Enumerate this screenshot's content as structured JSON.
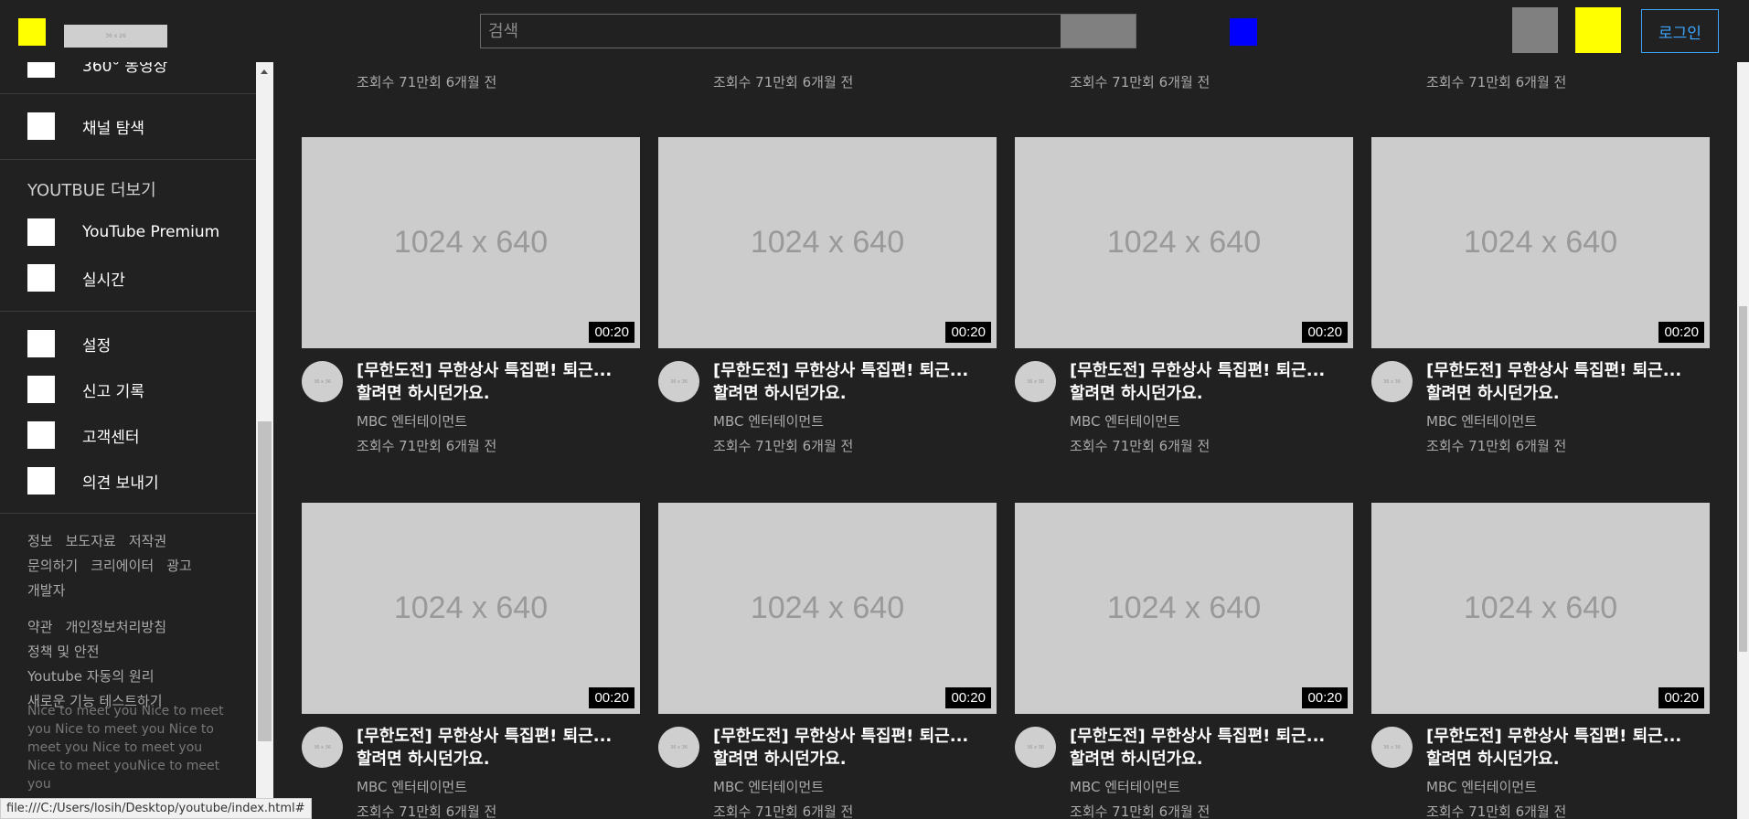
{
  "header": {
    "logo_image_text": "36 x 26",
    "search_placeholder": "검색",
    "login_label": "로그인"
  },
  "sidebar": {
    "partial_top": "360° 동영상",
    "channel_explore": "채널 탐색",
    "more_heading": "YOUTBUE 더보기",
    "more_items": [
      "YouTube Premium",
      "실시간"
    ],
    "settings_items": [
      "설정",
      "신고 기록",
      "고객센터",
      "의견 보내기"
    ],
    "footer_group1": [
      "정보",
      "보도자료",
      "저작권",
      "문의하기",
      "크리에이터",
      "광고",
      "개발자"
    ],
    "footer_group2": [
      "약관",
      "개인정보처리방침",
      "정책 및 안전",
      "Youtube 자동의 원리",
      "새로운 기능 테스트하기"
    ],
    "footer_note": "Nice to meet you Nice to meet you Nice to meet you Nice to meet you Nice to meet you Nice to meet youNice to meet you"
  },
  "video": {
    "thumb_text": "1024 x 640",
    "avatar_text": "36 x 36",
    "duration": "00:20",
    "title_line1": "[무한도전] 무한상사 특집편! 퇴근...",
    "title_line2": "할려면 하시던가요.",
    "channel": "MBC 엔터테이먼트",
    "stats": "조회수 71만회 6개월 전"
  },
  "status_url": "file:///C:/Users/losih/Desktop/youtube/index.html#",
  "colors": {
    "background": "#212121",
    "logo": "#ffff00",
    "mic": "#0000ff",
    "login": "#3ea6ff",
    "thumb": "#cccccc"
  }
}
